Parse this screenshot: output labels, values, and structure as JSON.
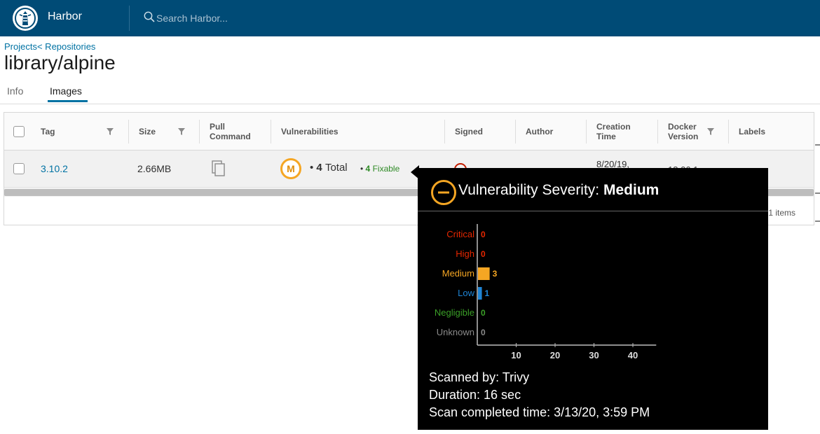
{
  "header": {
    "brand": "Harbor",
    "search_placeholder": "Search Harbor..."
  },
  "breadcrumb": {
    "projects": "Projects",
    "separator": "<",
    "repositories": " Repositories"
  },
  "page_title": "library/alpine",
  "tabs": [
    {
      "label": "Info",
      "active": false
    },
    {
      "label": "Images",
      "active": true
    }
  ],
  "table": {
    "columns": {
      "tag": "Tag",
      "size": "Size",
      "pull_1": "Pull",
      "pull_2": "Command",
      "vulnerabilities": "Vulnerabilities",
      "signed": "Signed",
      "author": "Author",
      "creation_1": "Creation",
      "creation_2": "Time",
      "docker_1": "Docker",
      "docker_2": "Version",
      "labels": "Labels"
    },
    "rows": [
      {
        "tag": "3.10.2",
        "size": "2.66MB",
        "severity_letter": "M",
        "total_count": "4",
        "total_label": "Total",
        "fixable_count": "4",
        "fixable_label": "Fixable",
        "creation_partial": "8/20/19,",
        "docker_partial": "18.06.1-ce"
      }
    ],
    "footer_count": "1 items"
  },
  "tooltip": {
    "title_prefix": "Vulnerability Severity:",
    "title_level": "Medium",
    "scanned_by": "Scanned by: Trivy",
    "duration": "Duration: 16 sec",
    "completed": "Scan completed time: 3/13/20, 3:59 PM"
  },
  "chart_data": {
    "type": "bar",
    "orientation": "horizontal",
    "categories": [
      "Critical",
      "High",
      "Medium",
      "Low",
      "Negligible",
      "Unknown"
    ],
    "values": [
      0,
      0,
      3,
      1,
      0,
      0
    ],
    "colors": [
      "#e62700",
      "#e62700",
      "#f5a623",
      "#1f85d6",
      "#3ba028",
      "#8a8a8a"
    ],
    "xticks": [
      10,
      20,
      30,
      40
    ],
    "xlim": [
      0,
      46
    ],
    "grid": false
  },
  "colors": {
    "header_bg": "#004b76",
    "link": "#0072a3",
    "medium": "#f5a623",
    "fixable": "#2e8a25",
    "tooltip_bg": "#000000"
  }
}
